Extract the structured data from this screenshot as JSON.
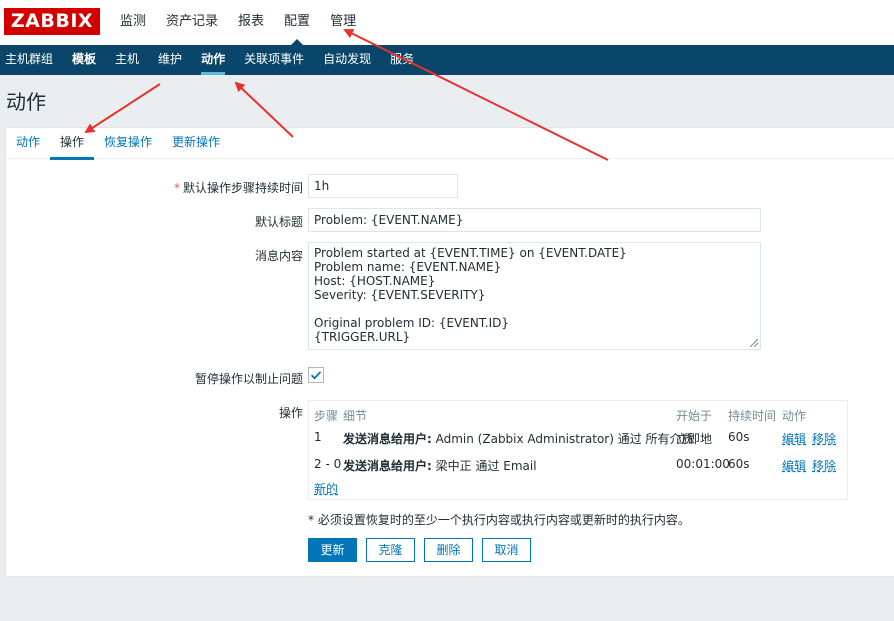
{
  "brand": {
    "logo_text": "ZABBIX",
    "logo_color": "#d40000"
  },
  "top_nav": [
    {
      "label": "监测"
    },
    {
      "label": "资产记录"
    },
    {
      "label": "报表"
    },
    {
      "label": "配置",
      "active": true
    },
    {
      "label": "管理"
    }
  ],
  "sub_nav": [
    {
      "label": "主机群组"
    },
    {
      "label": "模板"
    },
    {
      "label": "主机"
    },
    {
      "label": "维护"
    },
    {
      "label": "动作",
      "active": true
    },
    {
      "label": "关联项事件"
    },
    {
      "label": "自动发现"
    },
    {
      "label": "服务"
    }
  ],
  "page": {
    "title": "动作"
  },
  "tabs": [
    {
      "label": "动作"
    },
    {
      "label": "操作",
      "active": true
    },
    {
      "label": "恢复操作"
    },
    {
      "label": "更新操作"
    }
  ],
  "form": {
    "step_duration": {
      "label": "默认操作步骤持续时间",
      "value": "1h"
    },
    "subject": {
      "label": "默认标题",
      "value": "Problem: {EVENT.NAME}"
    },
    "message": {
      "label": "消息内容",
      "value": "Problem started at {EVENT.TIME} on {EVENT.DATE}\nProblem name: {EVENT.NAME}\nHost: {HOST.NAME}\nSeverity: {EVENT.SEVERITY}\n\nOriginal problem ID: {EVENT.ID}\n{TRIGGER.URL}"
    },
    "pause": {
      "label": "暂停操作以制止问题",
      "checked": true
    },
    "operations": {
      "label": "操作",
      "headers": {
        "steps": "步骤",
        "details": "细节",
        "start_in": "开始于",
        "duration": "持续时间",
        "action": "动作"
      },
      "rows": [
        {
          "steps": "1",
          "details_bold": "发送消息给用户:",
          "details_rest": " Admin (Zabbix Administrator) 通过 所有介质",
          "start_in": "立即地",
          "duration": "60s",
          "edit": "编辑",
          "remove": "移除"
        },
        {
          "steps": "2 - 0",
          "details_bold": "发送消息给用户:",
          "details_rest": " 梁中正 通过 Email",
          "start_in": "00:01:00",
          "duration": "60s",
          "edit": "编辑",
          "remove": "移除"
        }
      ],
      "new_link": "新的"
    },
    "note": "* 必须设置恢复时的至少一个执行内容或执行内容或更新时的执行内容。"
  },
  "buttons": {
    "update": "更新",
    "clone": "克隆",
    "delete": "删除",
    "cancel": "取消"
  },
  "colors": {
    "accent": "#0275b8",
    "subnav_bg": "#0a466a",
    "annotation_arrow": "#e8312a"
  }
}
